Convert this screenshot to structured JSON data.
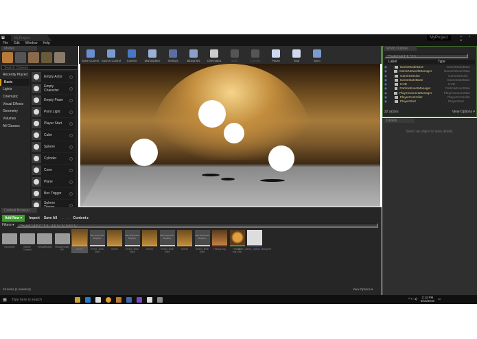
{
  "window": {
    "tab": "MyProject",
    "project": "MyProject",
    "controls": "– ▫ ×"
  },
  "menu": [
    "File",
    "Edit",
    "Window",
    "Help"
  ],
  "modes": {
    "tab": "Modes",
    "search_placeholder": "Search Classes",
    "categories": [
      "Recently Placed",
      "Basic",
      "Lights",
      "Cinematic",
      "Visual Effects",
      "Geometry",
      "Volumes",
      "All Classes"
    ],
    "selected_category": "Basic",
    "classes": [
      "Empty Actor",
      "Empty Character",
      "Empty Pawn",
      "Point Light",
      "Player Start",
      "Cube",
      "Sphere",
      "Cylinder",
      "Cone",
      "Plane",
      "Box Trigger",
      "Sphere Trigger"
    ]
  },
  "toolbar": [
    {
      "label": "Save Current",
      "color": "#6a8fd0"
    },
    {
      "label": "Source Control",
      "color": "#7a9ad0"
    },
    {
      "label": "Content",
      "color": "#4a78c8"
    },
    {
      "label": "Marketplace",
      "color": "#9ab0d8"
    },
    {
      "label": "Settings",
      "color": "#5a6fa0"
    },
    {
      "label": "Blueprints",
      "color": "#8aa0c8"
    },
    {
      "label": "Cinematics",
      "color": "#cccccc"
    },
    {
      "label": "Build",
      "color": "#555555",
      "disabled": true
    },
    {
      "label": "Compile",
      "color": "#555555",
      "disabled": true
    },
    {
      "label": "Pause",
      "color": "#cfd8ee"
    },
    {
      "label": "Stop",
      "color": "#cfd8ee"
    },
    {
      "label": "Eject",
      "color": "#7a9ad0"
    }
  ],
  "outliner": {
    "tab": "World Outliner",
    "search_placeholder": "Search...",
    "col_label": "Label",
    "col_type": "Type",
    "rows": [
      [
        "GameModeBase",
        "GameModeBase"
      ],
      [
        "GameNetworkManager",
        "GameNetworkMan"
      ],
      [
        "GameSession",
        "GameSession"
      ],
      [
        "GameStateBase",
        "GameStateBase"
      ],
      [
        "HUD",
        "HUD"
      ],
      [
        "ParticleEventManager",
        "ParticleEventMan"
      ],
      [
        "PlayerCameraManager",
        "PlayerCameraMan"
      ],
      [
        "PlayerController",
        "PlayerController"
      ],
      [
        "PlayerStart",
        "PlayerStart"
      ]
    ],
    "count": "22 actors",
    "view_options": "View Options ▾"
  },
  "details": {
    "tab": "Details",
    "message": "Select an object to view details."
  },
  "content_browser": {
    "tab": "Content Browser",
    "add_new": "Add New ▾",
    "import": "Import",
    "save_all": "Save All",
    "path": "Content ▸",
    "filters": "Filters ▾",
    "search_placeholder": "Search Assets",
    "assets": [
      {
        "name": "Geometry",
        "kind": "folder"
      },
      {
        "name": "Starter Content",
        "kind": "folder"
      },
      {
        "name": "VirtualReality",
        "kind": "folder"
      },
      {
        "name": "VirtualReality BP",
        "kind": "folder"
      },
      {
        "name": "level1",
        "kind": "level",
        "selected": true
      },
      {
        "name": "level1_Built Data",
        "kind": "data",
        "thumb": "Map Build Data Registry"
      },
      {
        "name": "level2",
        "kind": "level"
      },
      {
        "name": "level2_Built Data",
        "kind": "data",
        "thumb": "Map Build Data Registry"
      },
      {
        "name": "level3",
        "kind": "level"
      },
      {
        "name": "level3_Built Data",
        "kind": "data",
        "thumb": "Map Build Data Registry"
      },
      {
        "name": "level4",
        "kind": "level"
      },
      {
        "name": "level4_Built Data",
        "kind": "data",
        "thumb": "Map Build Data Registry"
      },
      {
        "name": "History-big",
        "kind": "texture"
      },
      {
        "name": "History-big_Mat",
        "kind": "material"
      },
      {
        "name": "Start_Game_Option_Blueprint",
        "kind": "blueprint"
      }
    ],
    "status": "15 items (1 selected)",
    "view_options": "View Options ▾"
  },
  "taskbar": {
    "search": "Type here to search",
    "time": "2:12 PM",
    "date": "9/15/2018"
  }
}
